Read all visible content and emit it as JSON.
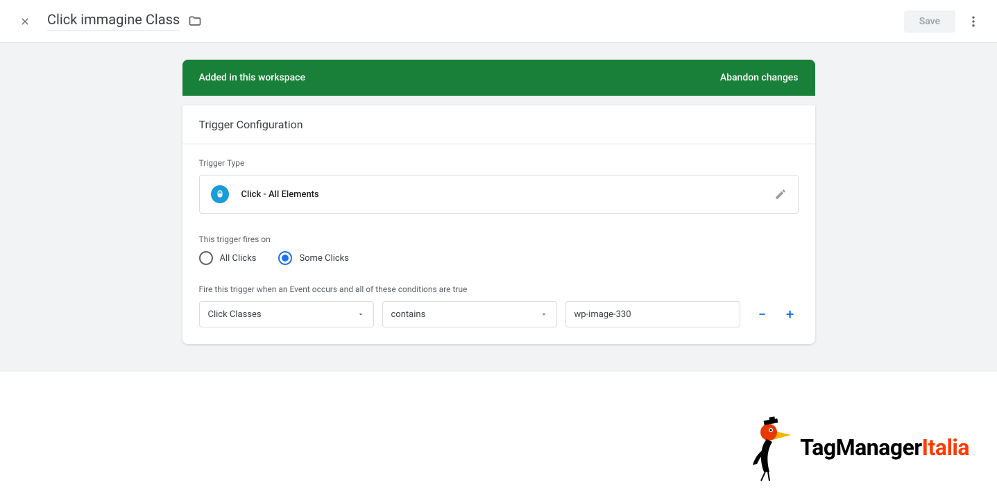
{
  "header": {
    "title": "Click immagine Class",
    "save_label": "Save"
  },
  "banner": {
    "message": "Added in this workspace",
    "abandon_label": "Abandon changes"
  },
  "config": {
    "section_title": "Trigger Configuration",
    "trigger_type_label": "Trigger Type",
    "trigger_type_value": "Click - All Elements",
    "fires_on_label": "This trigger fires on",
    "radio_all_label": "All Clicks",
    "radio_some_label": "Some Clicks",
    "radio_selected": "some",
    "conditions_label": "Fire this trigger when an Event occurs and all of these conditions are true",
    "condition": {
      "variable": "Click Classes",
      "operator": "contains",
      "value": "wp-image-330"
    }
  },
  "watermark": {
    "brand_prefix": "TagManager",
    "brand_suffix": "Italia"
  }
}
